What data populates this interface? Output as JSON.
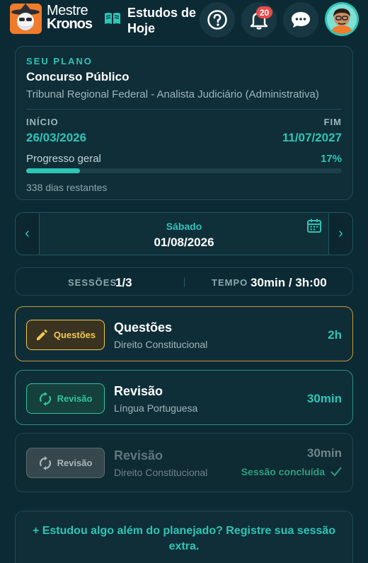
{
  "header": {
    "brand_line1": "Mestre",
    "brand_line2": "Kronos",
    "title": "Estudos de Hoje",
    "notification_count": "20",
    "icons": [
      "help-icon",
      "bell-icon",
      "chat-icon",
      "book-icon",
      "avatar"
    ]
  },
  "plan": {
    "eyebrow": "SEU PLANO",
    "title": "Concurso Público",
    "subtitle": "Tribunal Regional Federal - Analista Judiciário (Administrativa)",
    "start_label": "INÍCIO",
    "start_date": "26/03/2026",
    "end_label": "FIM",
    "end_date": "11/07/2027",
    "progress_label": "Progresso geral",
    "progress_pct": "17%",
    "progress_value": 0.17,
    "days_remaining": "338 dias restantes"
  },
  "day": {
    "weekday": "Sábado",
    "date": "01/08/2026",
    "prev": "‹",
    "next": "›"
  },
  "stats": {
    "sessions_label": "SESSÕES",
    "sessions_value": "1/3",
    "time_label": "TEMPO",
    "time_value": "30min / 3h:00"
  },
  "sessions": [
    {
      "chip": "Questões",
      "title": "Questões",
      "subject": "Direito Constitucional",
      "duration": "2h",
      "icon": "pencil-icon"
    },
    {
      "chip": "Revisão",
      "title": "Revisão",
      "subject": "Língua Portuguesa",
      "duration": "30min",
      "icon": "sync-icon"
    },
    {
      "chip": "Revisão",
      "title": "Revisão",
      "subject": "Direito Constitucional",
      "duration": "30min",
      "icon": "sync-icon",
      "status": "Sessão concluída"
    }
  ],
  "extra": {
    "text": "+ Estudou algo além do planejado? Registre sua sessão extra."
  },
  "colors": {
    "background": "#0c2a34",
    "accent": "#2ec4b6",
    "questions": "#f2c94c",
    "logo": "#f07b2a",
    "badge": "#e94b4b"
  }
}
